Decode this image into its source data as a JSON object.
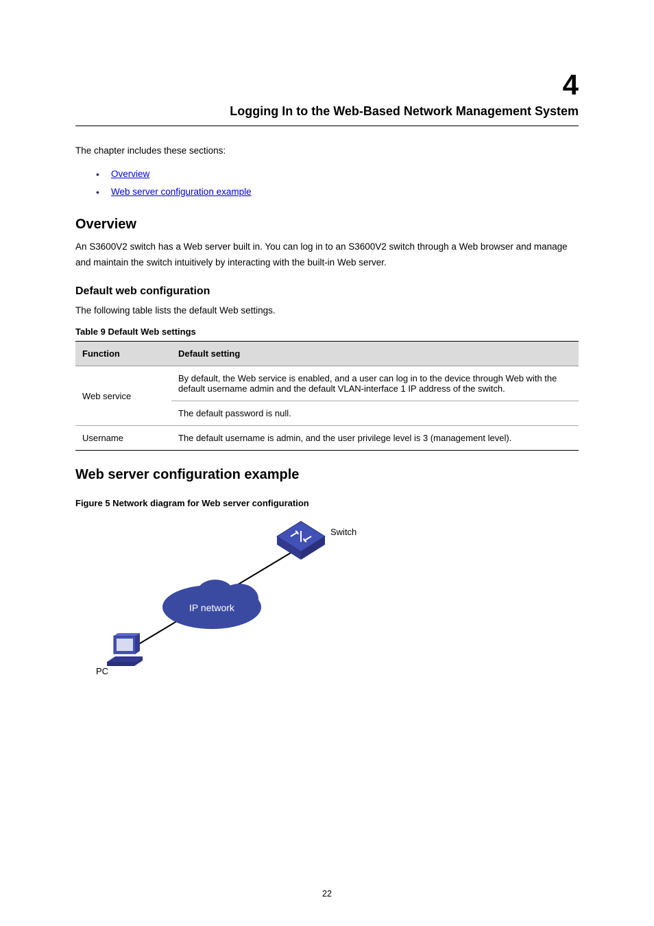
{
  "chapter": {
    "number": "4",
    "title": "Logging In to the Web-Based Network Management System"
  },
  "intro": "The chapter includes these sections:",
  "toc": [
    "Overview",
    "Web server configuration example"
  ],
  "sections": {
    "overview": {
      "heading": "Overview",
      "paragraph": "An S3600V2 switch has a Web server built in. You can log in to an S3600V2 switch through a Web browser and manage and maintain the switch intuitively by interacting with the built-in Web server.",
      "sub_heading": "Default web configuration",
      "sub_paragraph": "The following table lists the default Web settings.",
      "table": {
        "caption": "Table 9 Default Web settings",
        "headers": [
          "Function",
          "Default setting"
        ],
        "rows": [
          [
            "Web service",
            "By default, the Web service is enabled, and a user can log in to the device through Web with the default username admin and the default VLAN-interface 1 IP address of the switch."
          ],
          [
            "Web service",
            "The default password is null."
          ],
          [
            "Username",
            "The default username is admin, and the user privilege level is 3 (management level)."
          ]
        ]
      }
    },
    "example": {
      "heading": "Web server configuration example",
      "fig_caption": "Figure 5 Network diagram for Web server configuration",
      "labels": {
        "switch": "Switch",
        "cloud": "IP network",
        "pc": "PC"
      }
    }
  },
  "footer": {
    "page_number": "22"
  }
}
